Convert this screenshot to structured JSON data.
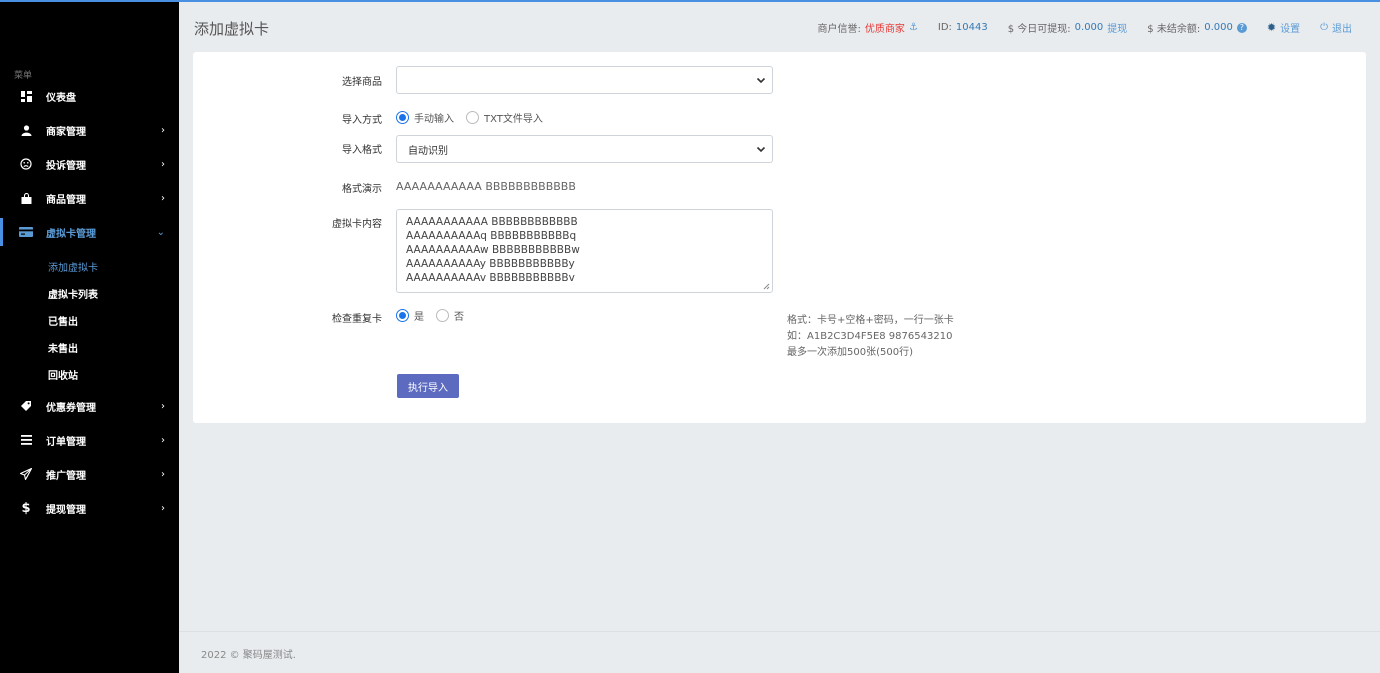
{
  "sidebar": {
    "caption": "菜单",
    "items": [
      {
        "label": "仪表盘",
        "icon": "dashboard-icon"
      },
      {
        "label": "商家管理",
        "icon": "user-icon"
      },
      {
        "label": "投诉管理",
        "icon": "frown-icon"
      },
      {
        "label": "商品管理",
        "icon": "shopping-bag-icon"
      },
      {
        "label": "虚拟卡管理",
        "icon": "credit-card-icon"
      },
      {
        "label": "优惠券管理",
        "icon": "tag-icon"
      },
      {
        "label": "订单管理",
        "icon": "list-icon"
      },
      {
        "label": "推广管理",
        "icon": "paper-plane-icon"
      },
      {
        "label": "提现管理",
        "icon": "dollar-icon"
      }
    ],
    "subitems": [
      "添加虚拟卡",
      "虚拟卡列表",
      "已售出",
      "未售出",
      "回收站"
    ]
  },
  "header": {
    "title": "添加虚拟卡",
    "credit_label": "商户信誉:",
    "credit_value": "优质商家",
    "id_label": "ID:",
    "id_value": "10443",
    "withdraw_label": "$ 今日可提现:",
    "withdraw_value": "0.000",
    "withdraw_link": "提现",
    "unsettled_label": "$ 未结余额:",
    "unsettled_value": "0.000",
    "settings_label": "设置",
    "logout_label": "退出"
  },
  "form": {
    "product_label": "选择商品",
    "product_value": "",
    "import_method_label": "导入方式",
    "import_methods": [
      "手动输入",
      "TXT文件导入"
    ],
    "import_format_label": "导入格式",
    "import_format_value": "自动识别",
    "demo_label": "格式演示",
    "demo_value": "AAAAAAAAAAA BBBBBBBBBBBB",
    "content_label": "虚拟卡内容",
    "content_lines": [
      "AAAAAAAAAAA BBBBBBBBBBBB",
      "AAAAAAAAAAq BBBBBBBBBBBq",
      "AAAAAAAAAAw BBBBBBBBBBBw",
      "AAAAAAAAAAy BBBBBBBBBBBy",
      "AAAAAAAAAAv BBBBBBBBBBBv"
    ],
    "check_dup_label": "检查重复卡",
    "check_dup_options": [
      "是",
      "否"
    ],
    "hint_lines": [
      "格式：卡号+空格+密码，一行一张卡",
      "如：A1B2C3D4F5E8 9876543210",
      "最多一次添加500张(500行)"
    ],
    "submit_label": "执行导入"
  },
  "footer": {
    "text": "2022 © 聚码屋测试."
  },
  "colors": {
    "accent": "#5b9bd5",
    "button": "#5c6bc0",
    "sidebar_bg": "#000000",
    "credit_red": "#e53935"
  }
}
